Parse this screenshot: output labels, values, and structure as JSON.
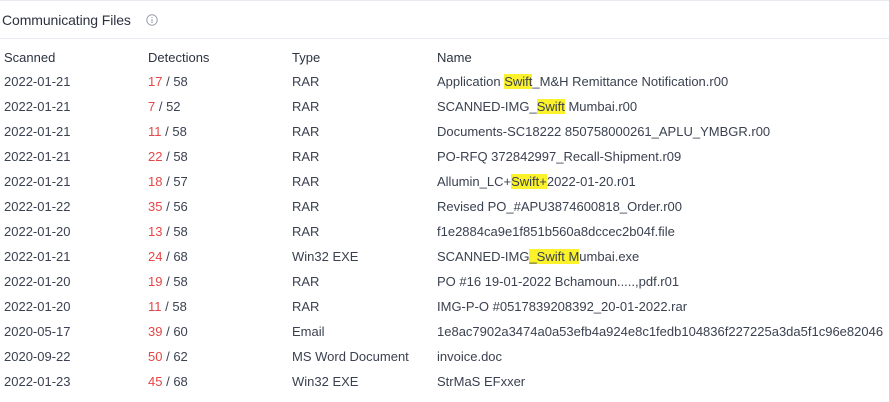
{
  "section": {
    "title": "Communicating Files",
    "info_icon": "info-circle-icon"
  },
  "table": {
    "headers": [
      "Scanned",
      "Detections",
      "Type",
      "Name"
    ],
    "rows": [
      {
        "scanned": "2022-01-21",
        "det_pos": "17",
        "det_total": "58",
        "type": "RAR",
        "name": [
          {
            "t": "Application "
          },
          {
            "t": "Swift",
            "hl": true
          },
          {
            "t": "_M&H Remittance Notification.r00"
          }
        ]
      },
      {
        "scanned": "2022-01-21",
        "det_pos": "7",
        "det_total": "52",
        "type": "RAR",
        "name": [
          {
            "t": "SCANNED-IMG_"
          },
          {
            "t": "Swift",
            "hl": true
          },
          {
            "t": " Mumbai.r00"
          }
        ]
      },
      {
        "scanned": "2022-01-21",
        "det_pos": "11",
        "det_total": "58",
        "type": "RAR",
        "name": [
          {
            "t": "Documents-SC18222 850758000261_APLU_YMBGR.r00"
          }
        ]
      },
      {
        "scanned": "2022-01-21",
        "det_pos": "22",
        "det_total": "58",
        "type": "RAR",
        "name": [
          {
            "t": "PO-RFQ 372842997_Recall-Shipment.r09"
          }
        ]
      },
      {
        "scanned": "2022-01-21",
        "det_pos": "18",
        "det_total": "57",
        "type": "RAR",
        "name": [
          {
            "t": "Allumin_LC+"
          },
          {
            "t": "Swift+",
            "hl": true
          },
          {
            "t": "2022-01-20.r01"
          }
        ]
      },
      {
        "scanned": "2022-01-22",
        "det_pos": "35",
        "det_total": "56",
        "type": "RAR",
        "name": [
          {
            "t": "Revised PO_#APU3874600818_Order.r00"
          }
        ]
      },
      {
        "scanned": "2022-01-20",
        "det_pos": "13",
        "det_total": "58",
        "type": "RAR",
        "name": [
          {
            "t": "f1e2884ca9e1f851b560a8dccec2b04f.file"
          }
        ]
      },
      {
        "scanned": "2022-01-21",
        "det_pos": "24",
        "det_total": "68",
        "type": "Win32 EXE",
        "name": [
          {
            "t": "SCANNED-IMG"
          },
          {
            "t": "_Swift M",
            "hl": true
          },
          {
            "t": "umbai.exe"
          }
        ]
      },
      {
        "scanned": "2022-01-20",
        "det_pos": "19",
        "det_total": "58",
        "type": "RAR",
        "name": [
          {
            "t": "PO #16 19-01-2022 Bchamoun.....,pdf.r01"
          }
        ]
      },
      {
        "scanned": "2022-01-20",
        "det_pos": "11",
        "det_total": "58",
        "type": "RAR",
        "name": [
          {
            "t": "IMG-P-O #0517839208392_20-01-2022.rar"
          }
        ]
      },
      {
        "scanned": "2020-05-17",
        "det_pos": "39",
        "det_total": "60",
        "type": "Email",
        "name": [
          {
            "t": "1e8ac7902a3474a0a53efb4a924e8c1fedb104836f227225a3da5f1c96e82046"
          }
        ]
      },
      {
        "scanned": "2020-09-22",
        "det_pos": "50",
        "det_total": "62",
        "type": "MS Word Document",
        "name": [
          {
            "t": "invoice.doc"
          }
        ]
      },
      {
        "scanned": "2022-01-23",
        "det_pos": "45",
        "det_total": "68",
        "type": "Win32 EXE",
        "name": [
          {
            "t": "StrMaS EFxxer"
          }
        ]
      }
    ]
  },
  "colors": {
    "detection_positive": "#e54646",
    "highlight": "#fbf22c"
  }
}
